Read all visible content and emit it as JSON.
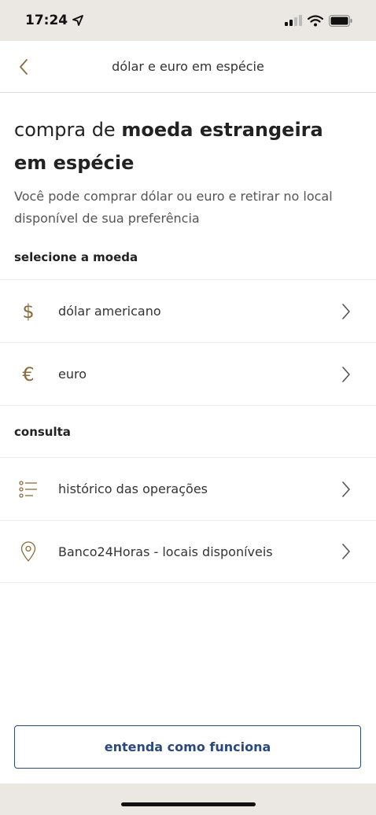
{
  "status_bar": {
    "time": "17:24"
  },
  "nav": {
    "title": "dólar e euro em espécie"
  },
  "heading": {
    "light": "compra de ",
    "bold": "moeda estrangeira em espécie"
  },
  "subtitle": "Você pode comprar dólar ou euro e retirar no local disponível de sua preferência",
  "section_currency": {
    "label": "selecione a moeda",
    "items": [
      {
        "glyph": "$",
        "icon": "dollar-icon",
        "label": "dólar americano"
      },
      {
        "glyph": "€",
        "icon": "euro-icon",
        "label": "euro"
      }
    ]
  },
  "section_query": {
    "label": "consulta",
    "items": [
      {
        "icon": "list-icon",
        "label": "histórico das operações"
      },
      {
        "icon": "location-pin-icon",
        "label": "Banco24Horas - locais disponíveis"
      }
    ]
  },
  "cta": {
    "label": "entenda como funciona"
  },
  "colors": {
    "accent_gold": "#8a6d3b",
    "button_blue": "#2a4a7f",
    "status_bg": "#ebe7e2"
  }
}
